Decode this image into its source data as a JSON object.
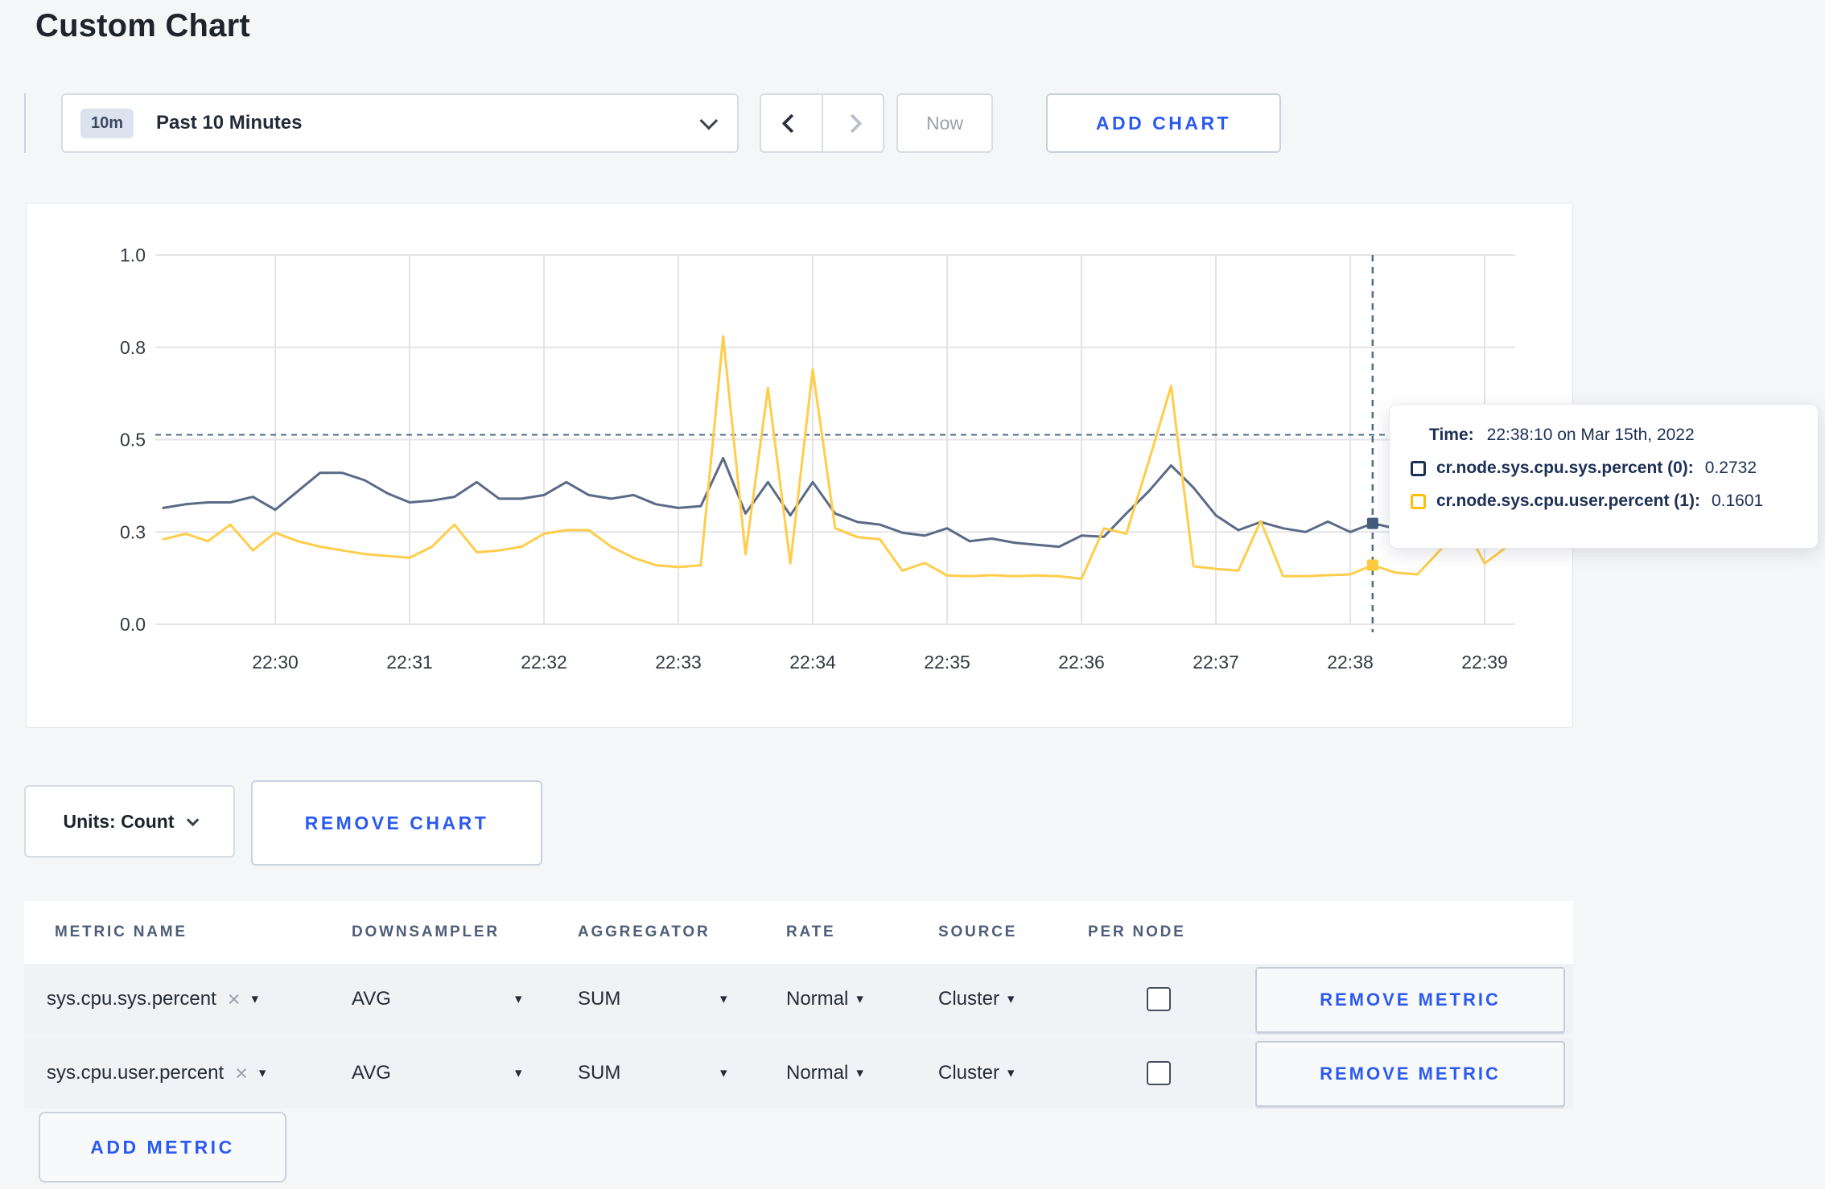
{
  "page": {
    "title": "Custom Chart"
  },
  "toolbar": {
    "time_range_badge": "10m",
    "time_range_label": "Past 10 Minutes",
    "now_label": "Now",
    "add_chart_label": "ADD CHART"
  },
  "units": {
    "label": "Units: Count"
  },
  "remove_chart_label": "REMOVE CHART",
  "colors": {
    "accent_blue": "#2b5af0",
    "series_sys_line": "#5a6a87",
    "series_user_line": "#ffcd4a",
    "tooltip_navy": "#1c2f55",
    "tooltip_yellow": "#ffbe06",
    "crosshair": "#4f6d89",
    "gridline": "#e4e4e7"
  },
  "chart_data": {
    "type": "line",
    "title": "",
    "xlabel": "",
    "ylabel": "",
    "ylim": [
      0,
      1
    ],
    "grid": true,
    "yticks": [
      {
        "label": "0.0",
        "value": 0
      },
      {
        "label": "0.3",
        "value": 0.25
      },
      {
        "label": "0.5",
        "value": 0.5
      },
      {
        "label": "0.8",
        "value": 0.75
      },
      {
        "label": "1.0",
        "value": 1
      }
    ],
    "xticks": [
      "22:30",
      "22:31",
      "22:32",
      "22:33",
      "22:34",
      "22:35",
      "22:36",
      "22:37",
      "22:38",
      "22:39"
    ],
    "x_start_min": -0.8333,
    "interval_min": 0.16667,
    "series": [
      {
        "name": "cr.node.sys.cpu.sys.percent (0)",
        "color": "#5a6a87",
        "values": [
          0.315,
          0.325,
          0.33,
          0.33,
          0.345,
          0.31,
          0.36,
          0.41,
          0.41,
          0.39,
          0.355,
          0.33,
          0.335,
          0.345,
          0.385,
          0.34,
          0.34,
          0.35,
          0.385,
          0.35,
          0.34,
          0.35,
          0.325,
          0.315,
          0.32,
          0.45,
          0.3,
          0.385,
          0.295,
          0.385,
          0.3,
          0.277,
          0.27,
          0.248,
          0.24,
          0.26,
          0.225,
          0.232,
          0.221,
          0.215,
          0.21,
          0.24,
          0.237,
          0.3,
          0.36,
          0.43,
          0.37,
          0.295,
          0.255,
          0.277,
          0.26,
          0.25,
          0.278,
          0.25,
          0.2732,
          0.26,
          0.27,
          0.29,
          0.3,
          0.31,
          0.32
        ]
      },
      {
        "name": "cr.node.sys.cpu.user.percent (1)",
        "color": "#ffcd4a",
        "values": [
          0.23,
          0.245,
          0.225,
          0.27,
          0.2,
          0.248,
          0.225,
          0.21,
          0.2,
          0.19,
          0.185,
          0.18,
          0.21,
          0.27,
          0.195,
          0.2,
          0.21,
          0.245,
          0.255,
          0.255,
          0.21,
          0.18,
          0.16,
          0.155,
          0.16,
          0.78,
          0.19,
          0.64,
          0.165,
          0.69,
          0.26,
          0.236,
          0.23,
          0.145,
          0.166,
          0.132,
          0.13,
          0.133,
          0.13,
          0.132,
          0.13,
          0.123,
          0.26,
          0.245,
          0.44,
          0.645,
          0.157,
          0.15,
          0.145,
          0.28,
          0.13,
          0.13,
          0.133,
          0.135,
          0.1601,
          0.14,
          0.135,
          0.2,
          0.28,
          0.165,
          0.21
        ]
      }
    ],
    "crosshair": {
      "x_min": 8.1667,
      "hline_value": 0.513,
      "points": [
        {
          "series": 0,
          "value": 0.2732,
          "color": "#465a7d"
        },
        {
          "series": 1,
          "value": 0.1601,
          "color": "#ffc93d"
        }
      ]
    },
    "legend_position": "tooltip"
  },
  "tooltip": {
    "time_label": "Time:",
    "time_value": "22:38:10 on Mar 15th, 2022",
    "rows": [
      {
        "label": "cr.node.sys.cpu.sys.percent (0):",
        "value": "0.2732"
      },
      {
        "label": "cr.node.sys.cpu.user.percent (1):",
        "value": "0.1601"
      }
    ]
  },
  "table": {
    "headers": [
      "METRIC NAME",
      "DOWNSAMPLER",
      "AGGREGATOR",
      "RATE",
      "SOURCE",
      "PER NODE"
    ],
    "rows": [
      {
        "metric_name": "sys.cpu.sys.percent",
        "remove_icon": "×",
        "downsampler": "AVG",
        "aggregator": "SUM",
        "rate": "Normal",
        "source": "Cluster",
        "per_node_checked": false,
        "remove_label": "REMOVE METRIC"
      },
      {
        "metric_name": "sys.cpu.user.percent",
        "remove_icon": "×",
        "downsampler": "AVG",
        "aggregator": "SUM",
        "rate": "Normal",
        "source": "Cluster",
        "per_node_checked": false,
        "remove_label": "REMOVE METRIC"
      }
    ],
    "triangle": "▾",
    "add_metric_label": "ADD METRIC"
  }
}
